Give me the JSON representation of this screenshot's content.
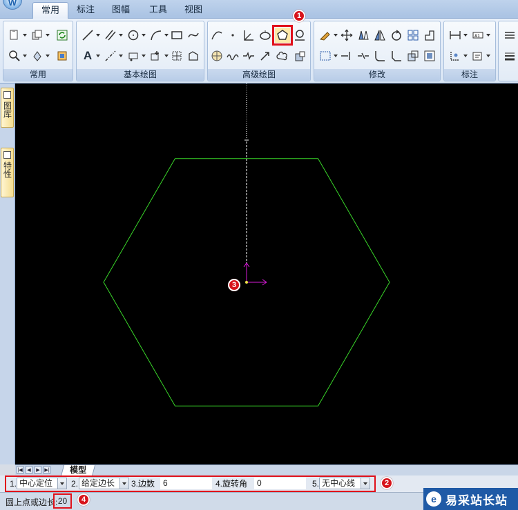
{
  "app": {
    "menu_logo": "W",
    "tabs": [
      "常用",
      "标注",
      "图幅",
      "工具",
      "视图"
    ],
    "active_tab": "常用"
  },
  "ribbon": {
    "groups": [
      {
        "name": "常用"
      },
      {
        "name": "基本绘图"
      },
      {
        "name": "高级绘图"
      },
      {
        "name": "修改"
      },
      {
        "name": "标注"
      }
    ],
    "highlighted_tool": "polygon-icon"
  },
  "left_dock": {
    "tabs": [
      "图库",
      "特性"
    ]
  },
  "canvas": {
    "background": "#000000",
    "shape_color": "#39d629",
    "axis_color": "#d81bd8",
    "crosshair_color": "#ffffff"
  },
  "layout_tabs": {
    "active": "模型"
  },
  "command_options": {
    "opt1_num": "1.",
    "opt1_value": "中心定位",
    "opt2_num": "2.",
    "opt2_value": "给定边长",
    "opt3_label": "3.边数",
    "opt3_value": "6",
    "opt4_label": "4.旋转角",
    "opt4_value": "0",
    "opt5_num": "5.",
    "opt5_value": "无中心线"
  },
  "status": {
    "prompt": "圆上点或边长:",
    "entry": "20"
  },
  "badges": [
    "1",
    "2",
    "3",
    "4"
  ],
  "watermark": {
    "text": "易采站长站",
    "logo": "e"
  }
}
